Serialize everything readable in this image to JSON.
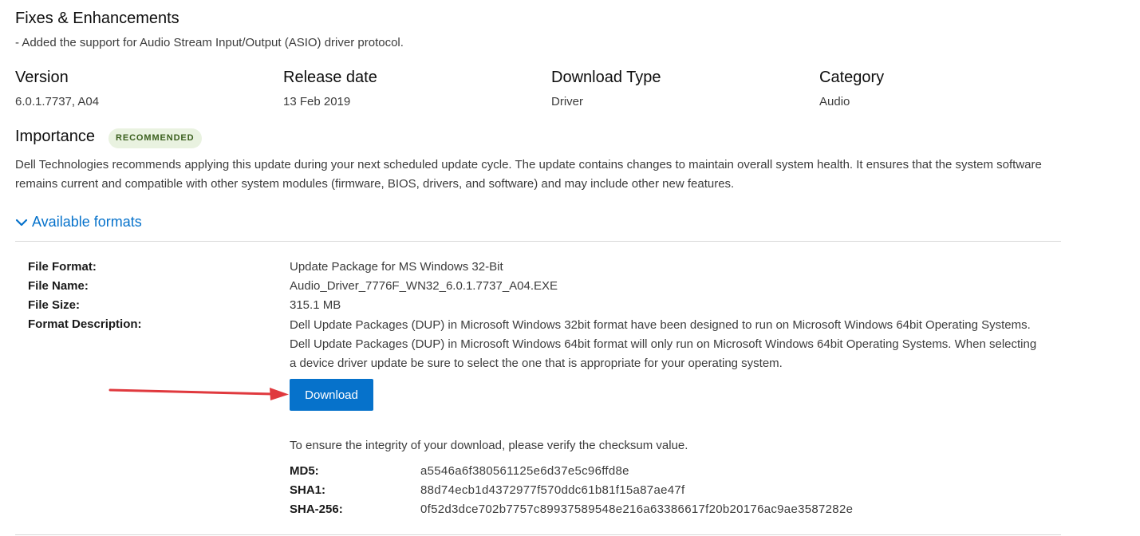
{
  "fixes": {
    "heading": "Fixes & Enhancements",
    "note": "- Added the support for Audio Stream Input/Output (ASIO) driver protocol."
  },
  "meta": [
    {
      "label": "Version",
      "value": "6.0.1.7737, A04"
    },
    {
      "label": "Release date",
      "value": "13 Feb 2019"
    },
    {
      "label": "Download Type",
      "value": "Driver"
    },
    {
      "label": "Category",
      "value": "Audio"
    }
  ],
  "importance": {
    "heading": "Importance",
    "badge": "RECOMMENDED",
    "description": "Dell Technologies recommends applying this update during your next scheduled update cycle. The update contains changes to maintain overall system health. It ensures that the system software remains current and compatible with other system modules (firmware, BIOS, drivers, and software) and may include other new features."
  },
  "formats": {
    "toggle_label": "Available formats",
    "toggle_icon": "chevron-down-icon",
    "file_format_label": "File Format:",
    "file_format_value": "Update Package for MS Windows 32-Bit",
    "file_name_label": "File Name:",
    "file_name_value": "Audio_Driver_7776F_WN32_6.0.1.7737_A04.EXE",
    "file_size_label": "File Size:",
    "file_size_value": "315.1 MB",
    "format_desc_label": "Format Description:",
    "format_desc_value": "Dell Update Packages (DUP) in Microsoft Windows 32bit format have been designed to run on Microsoft Windows 64bit Operating Systems. Dell Update Packages (DUP) in Microsoft Windows 64bit format will only run on Microsoft Windows 64bit Operating Systems. When selecting a device driver update be sure to select the one that is appropriate for your operating system.",
    "download_label": "Download",
    "checksum_note": "To ensure the integrity of your download, please verify the checksum value.",
    "checksums": [
      {
        "label": "MD5:",
        "value": "a5546a6f380561125e6d37e5c96ffd8e"
      },
      {
        "label": "SHA1:",
        "value": "88d74ecb1d4372977f570ddc61b81f15a87ae47f"
      },
      {
        "label": "SHA-256:",
        "value": "0f52d3dce702b7757c89937589548e216a63386617f20b20176ac9ae3587282e"
      }
    ]
  },
  "colors": {
    "accent": "#0672cb",
    "badge_bg": "#e9f2e0",
    "badge_text": "#3a5f1d",
    "annotation_arrow": "#e0393e"
  }
}
